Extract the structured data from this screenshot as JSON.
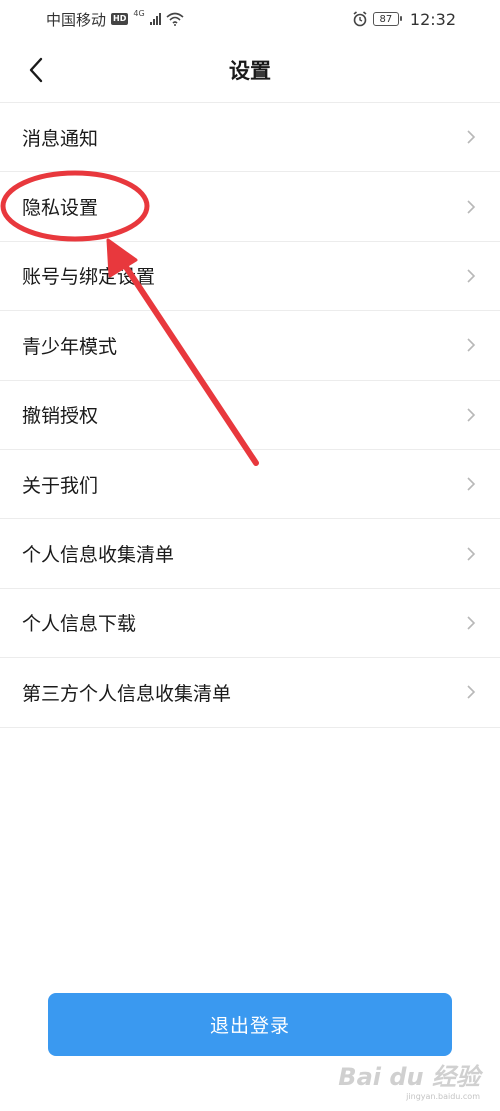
{
  "status_bar": {
    "carrier": "中国移动",
    "hd_badge": "HD",
    "network": "4G",
    "battery": "87",
    "time": "12:32"
  },
  "header": {
    "title": "设置",
    "back_icon": "chevron-left-icon"
  },
  "settings": {
    "items": [
      {
        "label": "消息通知"
      },
      {
        "label": "隐私设置"
      },
      {
        "label": "账号与绑定设置"
      },
      {
        "label": "青少年模式"
      },
      {
        "label": "撤销授权"
      },
      {
        "label": "关于我们"
      },
      {
        "label": "个人信息收集清单"
      },
      {
        "label": "个人信息下载"
      },
      {
        "label": "第三方个人信息收集清单"
      }
    ],
    "chevron_icon": "chevron-right-icon"
  },
  "logout": {
    "label": "退出登录"
  },
  "watermark": {
    "text": "Bai du 经验",
    "sub": "jingyan.baidu.com"
  },
  "colors": {
    "accent": "#3a99f0",
    "annotation": "#e8383d",
    "divider": "#ececec",
    "chevron": "#b8b8b8"
  }
}
